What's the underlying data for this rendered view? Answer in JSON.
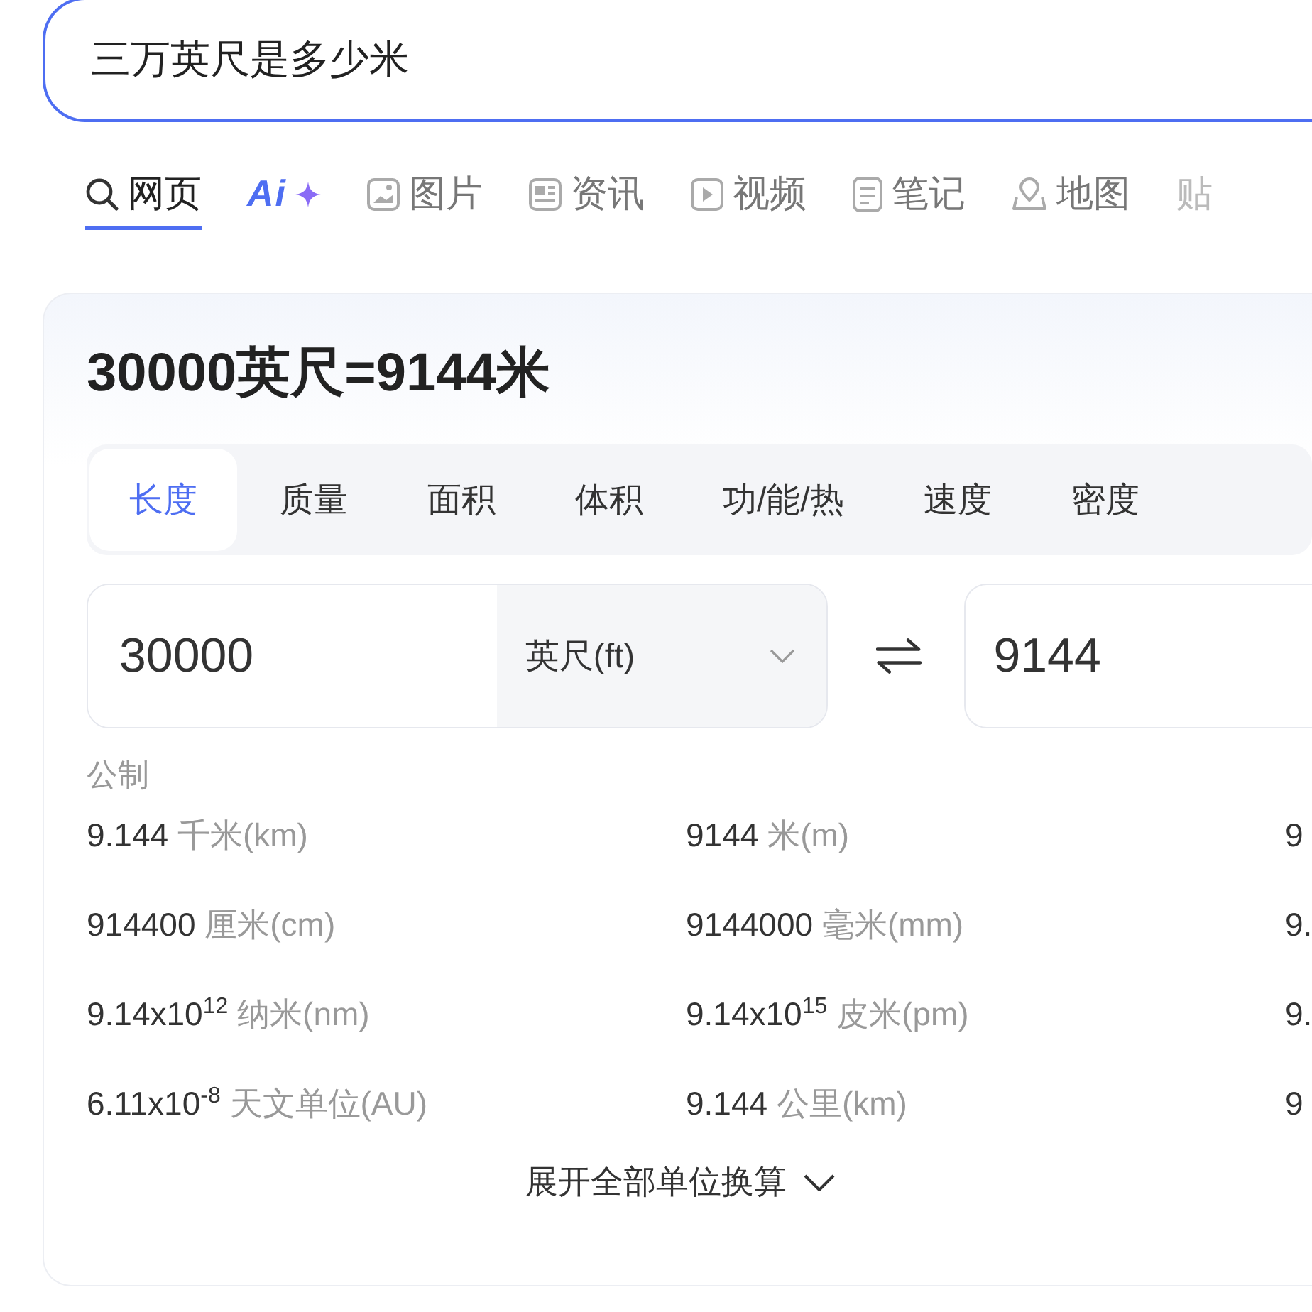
{
  "search": {
    "value": "三万英尺是多少米"
  },
  "tabs": [
    {
      "label": "网页",
      "kind": "text",
      "selected": true
    },
    {
      "label": "Ai",
      "kind": "logo",
      "selected": false
    },
    {
      "label": "图片",
      "kind": "text",
      "selected": false
    },
    {
      "label": "资讯",
      "kind": "text",
      "selected": false
    },
    {
      "label": "视频",
      "kind": "text",
      "selected": false
    },
    {
      "label": "笔记",
      "kind": "text",
      "selected": false
    },
    {
      "label": "地图",
      "kind": "text",
      "selected": false
    },
    {
      "label": "贴",
      "kind": "text",
      "selected": false
    }
  ],
  "converter": {
    "result_title": "30000英尺=9144米",
    "categories": [
      {
        "label": "长度",
        "selected": true
      },
      {
        "label": "质量",
        "selected": false
      },
      {
        "label": "面积",
        "selected": false
      },
      {
        "label": "体积",
        "selected": false
      },
      {
        "label": "功/能/热",
        "selected": false
      },
      {
        "label": "速度",
        "selected": false
      },
      {
        "label": "密度",
        "selected": false
      }
    ],
    "from_value": "30000",
    "from_unit": "英尺(ft)",
    "to_value": "9144",
    "section": "公制",
    "columns": [
      [
        {
          "value": "9.144",
          "unit": "千米(km)"
        },
        {
          "value": "914400",
          "unit": "厘米(cm)"
        },
        {
          "value": "9.14x10$^{12}$",
          "unit": "纳米(nm)"
        },
        {
          "value": "6.11x10$^{-8}$",
          "unit": "天文单位(AU)"
        }
      ],
      [
        {
          "value": "9144",
          "unit": "米(m)"
        },
        {
          "value": "9144000",
          "unit": "毫米(mm)"
        },
        {
          "value": "9.14x10$^{15}$",
          "unit": "皮米(pm)"
        },
        {
          "value": "9.144",
          "unit": "公里(km)"
        }
      ],
      [
        {
          "value": "9"
        },
        {
          "value": "9."
        },
        {
          "value": "9."
        },
        {
          "value": "9"
        }
      ]
    ],
    "expand": "展开全部单位换算"
  }
}
